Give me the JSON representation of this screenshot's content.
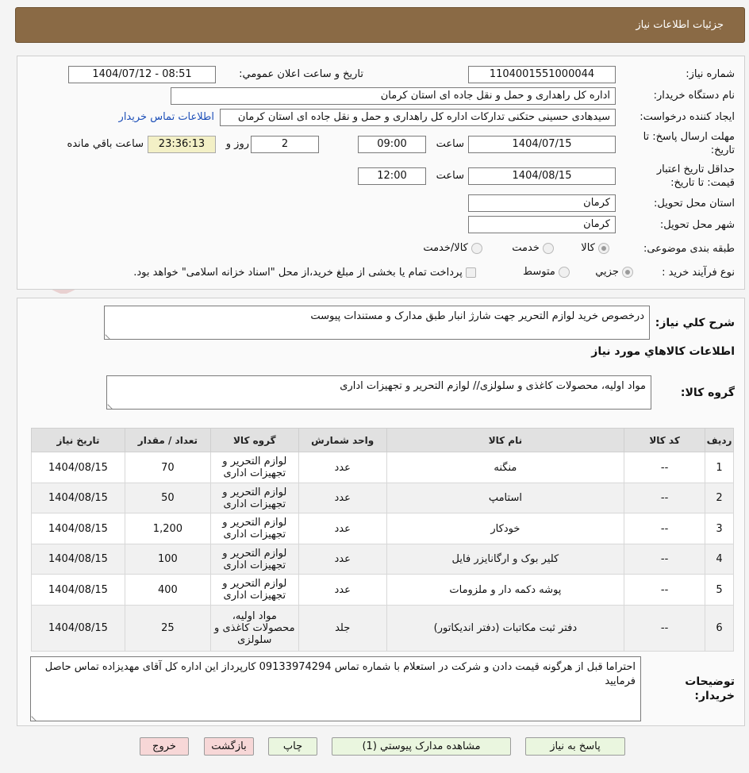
{
  "header": {
    "title": "جزئیات اطلاعات نیاز"
  },
  "form": {
    "need_number_label": "شماره نیاز:",
    "need_number": "1104001551000044",
    "announce_label": "تاریخ و ساعت اعلان عمومي:",
    "announce_value": "1404/07/12 - 08:51",
    "buyer_org_label": "نام دستگاه خريدار:",
    "buyer_org": "اداره کل راهداری و حمل و نقل جاده ای استان کرمان",
    "requester_label": "ايجاد کننده درخواست:",
    "requester": "سیدهادی حسینی حتکنی تدارکات اداره کل راهداری و حمل و نقل جاده ای استان کرمان",
    "contact_link": "اطلاعات تماس خريدار",
    "deadline_label_1": "مهلت ارسال پاسخ: تا",
    "deadline_label_2": "تاريخ:",
    "deadline_date": "1404/07/15",
    "time_word": "ساعت",
    "deadline_time": "09:00",
    "days_value": "2",
    "days_word": "روز و",
    "remaining_time": "23:36:13",
    "remaining_word": "ساعت باقي مانده",
    "validity_label_1": "حداقل تاريخ اعتبار",
    "validity_label_2": "قيمت: تا تاريخ:",
    "validity_date": "1404/08/15",
    "validity_time": "12:00",
    "province_label": "استان محل تحويل:",
    "province": "کرمان",
    "city_label": "شهر محل تحويل:",
    "city": "کرمان",
    "category_label": "طبقه بندی موضوعی:",
    "category_options": [
      "کالا",
      "خدمت",
      "کالا/خدمت"
    ],
    "category_selected": "کالا",
    "process_label": "نوع فرآيند خريد :",
    "process_options": [
      "جزيي",
      "متوسط"
    ],
    "process_selected": "جزيي",
    "payment_note": "پرداخت تمام يا بخشی از مبلغ خريد،از محل \"اسناد خزانه اسلامی\" خواهد بود."
  },
  "details": {
    "summary_label": "شرح کلي نياز:",
    "summary_text": "درخصوص خرید لوازم التحریر جهت شارژ انبار طبق مدارک و مستندات پیوست",
    "goods_info_title": "اطلاعات کالاهاي مورد نياز",
    "goods_group_label": "گروه کالا:",
    "goods_group_text": "مواد اولیه، محصولات کاغذی و سلولزی// لوازم التحریر و تجهیزات اداری"
  },
  "table": {
    "headers": [
      "رديف",
      "کد کالا",
      "نام کالا",
      "واحد شمارش",
      "گروه کالا",
      "تعداد / مقدار",
      "تاريخ نياز"
    ],
    "rows": [
      [
        "1",
        "--",
        "منگنه",
        "عدد",
        "لوازم التحریر و تجهیزات اداری",
        "70",
        "1404/08/15"
      ],
      [
        "2",
        "--",
        "استامپ",
        "عدد",
        "لوازم التحریر و تجهیزات اداری",
        "50",
        "1404/08/15"
      ],
      [
        "3",
        "--",
        "خودکار",
        "عدد",
        "لوازم التحریر و تجهیزات اداری",
        "1,200",
        "1404/08/15"
      ],
      [
        "4",
        "--",
        "کلیر بوک و ارگانایزر فایل",
        "عدد",
        "لوازم التحریر و تجهیزات اداری",
        "100",
        "1404/08/15"
      ],
      [
        "5",
        "--",
        "پوشه دکمه دار و ملزومات",
        "عدد",
        "لوازم التحریر و تجهیزات اداری",
        "400",
        "1404/08/15"
      ],
      [
        "6",
        "--",
        "دفتر ثبت مکاتبات (دفتر اندیکاتور)",
        "جلد",
        "مواد اولیه، محصولات کاغذی و سلولزی",
        "25",
        "1404/08/15"
      ]
    ]
  },
  "buyer_notes": {
    "label": "توضيحات خريدار:",
    "text": "احتراما قبل از هرگونه قیمت دادن و شرکت در استعلام با شماره تماس 09133974294 کارپرداز این اداره کل آقای مهدیزاده تماس حاصل فرمایید"
  },
  "buttons": {
    "reply": "پاسخ به نياز",
    "attachments": "مشاهده مدارک پيوستي (1)",
    "print": "چاپ",
    "back": "بازگشت",
    "exit": "خروج"
  },
  "watermark": {
    "text": "AriaTender.neT"
  },
  "colors": {
    "header": "#8a6a45",
    "link": "#1d4fb8",
    "button_green": "#eaf6df",
    "button_pink": "#f7d7d7"
  }
}
